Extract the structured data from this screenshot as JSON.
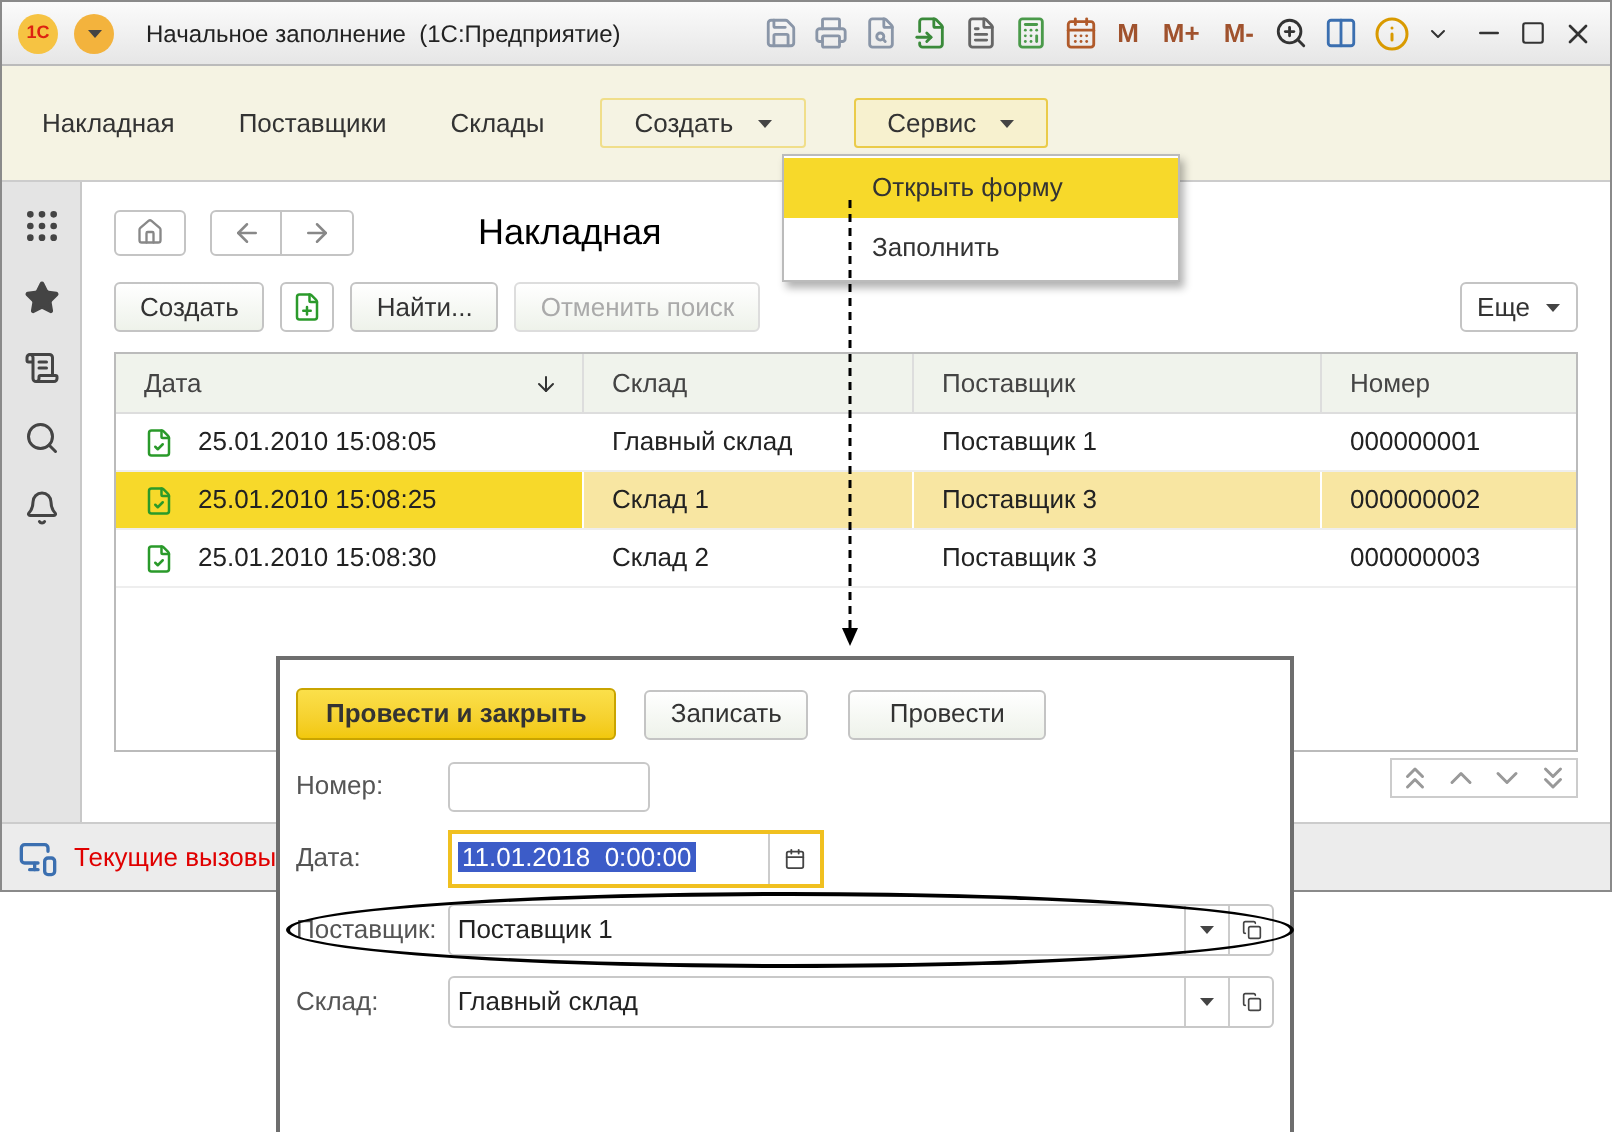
{
  "window": {
    "logo": "1С",
    "title": "Начальное заполнение  (1С:Предприятие)",
    "memory_buttons": [
      "M",
      "M+",
      "M-"
    ]
  },
  "sections": [
    {
      "label": "Накладная",
      "kind": "link"
    },
    {
      "label": "Поставщики",
      "kind": "link"
    },
    {
      "label": "Склады",
      "kind": "link"
    },
    {
      "label": "Создать",
      "kind": "menu",
      "expanded": false
    },
    {
      "label": "Сервис",
      "kind": "menu",
      "expanded": true
    }
  ],
  "service_menu": [
    {
      "label": "Открыть форму",
      "selected": true
    },
    {
      "label": "Заполнить",
      "selected": false
    }
  ],
  "list_form": {
    "title": "Накладная",
    "buttons": [
      {
        "label": "Создать",
        "disabled": false
      },
      {
        "label": "Найти...",
        "disabled": false
      },
      {
        "label": "Отменить поиск",
        "disabled": true
      }
    ],
    "more": "Еще",
    "columns": [
      "Дата",
      "Склад",
      "Поставщик",
      "Номер"
    ],
    "rows": [
      {
        "cells": [
          "25.01.2010 15:08:05",
          "Главный склад",
          "Поставщик 1",
          "000000001"
        ],
        "selected": false
      },
      {
        "cells": [
          "25.01.2010 15:08:25",
          "Склад 1",
          "Поставщик 3",
          "000000002"
        ],
        "selected": true
      },
      {
        "cells": [
          "25.01.2010 15:08:30",
          "Склад 2",
          "Поставщик 3",
          "000000003"
        ],
        "selected": false
      }
    ]
  },
  "status_bar": {
    "text": "Текущие вызовы"
  },
  "document_form": {
    "buttons": [
      {
        "label": "Провести и закрыть",
        "kind": "primary"
      },
      {
        "label": "Записать",
        "kind": "normal"
      },
      {
        "label": "Провести",
        "kind": "normal"
      }
    ],
    "fields": [
      {
        "label": "Номер:",
        "kind": "text",
        "focused": false,
        "circled": false
      },
      {
        "label": "Дата:",
        "value": "11.01.2018  0:00:00",
        "kind": "date",
        "focused": true,
        "circled": false
      },
      {
        "label": "Поставщик:",
        "value": "Поставщик 1",
        "kind": "select",
        "focused": false,
        "circled": true
      },
      {
        "label": "Склад:",
        "value": "Главный склад",
        "kind": "select",
        "focused": false,
        "circled": false
      }
    ]
  }
}
